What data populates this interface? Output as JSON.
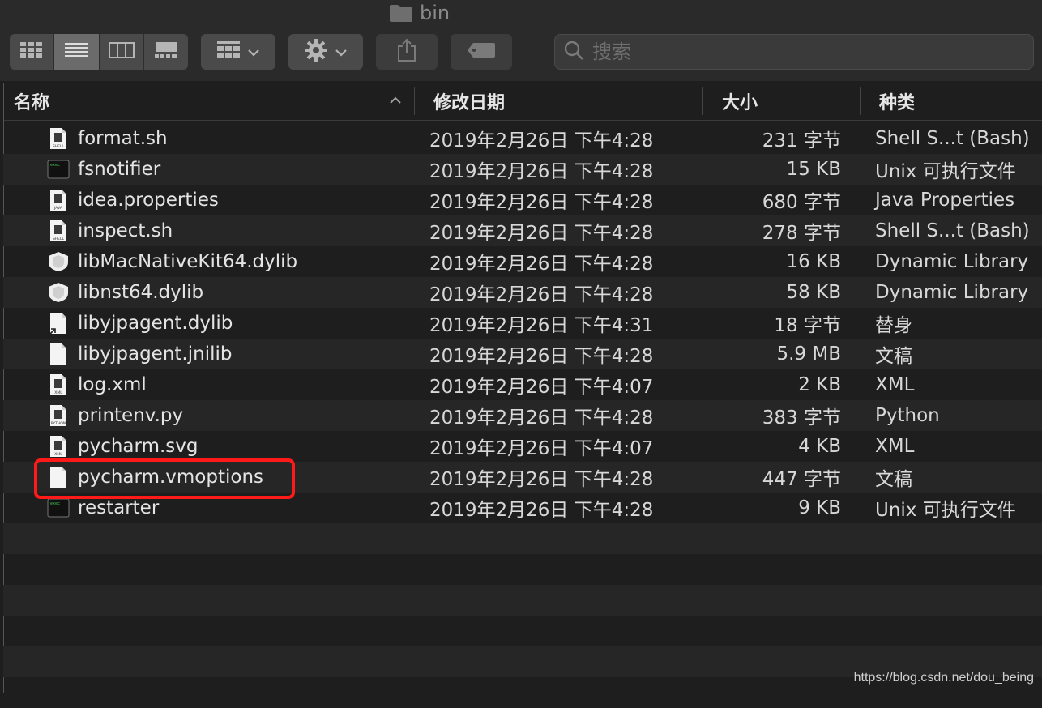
{
  "window": {
    "title": "bin"
  },
  "toolbar": {
    "search_placeholder": "搜索"
  },
  "columns": {
    "name": "名称",
    "date": "修改日期",
    "size": "大小",
    "kind": "种类"
  },
  "files": [
    {
      "name": "format.sh",
      "date": "2019年2月26日 下午4:28",
      "size": "231 字节",
      "kind": "Shell S...t (Bash)",
      "icon": "shell-doc-icon"
    },
    {
      "name": "fsnotifier",
      "date": "2019年2月26日 下午4:28",
      "size": "15 KB",
      "kind": "Unix 可执行文件",
      "icon": "terminal-exec-icon"
    },
    {
      "name": "idea.properties",
      "date": "2019年2月26日 下午4:28",
      "size": "680 字节",
      "kind": "Java Properties",
      "icon": "java-doc-icon"
    },
    {
      "name": "inspect.sh",
      "date": "2019年2月26日 下午4:28",
      "size": "278 字节",
      "kind": "Shell S...t (Bash)",
      "icon": "shell-doc-icon"
    },
    {
      "name": "libMacNativeKit64.dylib",
      "date": "2019年2月26日 下午4:28",
      "size": "16 KB",
      "kind": "Dynamic Library",
      "icon": "dylib-icon"
    },
    {
      "name": "libnst64.dylib",
      "date": "2019年2月26日 下午4:28",
      "size": "58 KB",
      "kind": "Dynamic Library",
      "icon": "dylib-icon"
    },
    {
      "name": "libyjpagent.dylib",
      "date": "2019年2月26日 下午4:31",
      "size": "18 字节",
      "kind": "替身",
      "icon": "alias-icon"
    },
    {
      "name": "libyjpagent.jnilib",
      "date": "2019年2月26日 下午4:28",
      "size": "5.9 MB",
      "kind": "文稿",
      "icon": "blank-doc-icon"
    },
    {
      "name": "log.xml",
      "date": "2019年2月26日 下午4:07",
      "size": "2 KB",
      "kind": "XML",
      "icon": "xml-doc-icon"
    },
    {
      "name": "printenv.py",
      "date": "2019年2月26日 下午4:28",
      "size": "383 字节",
      "kind": "Python",
      "icon": "python-doc-icon"
    },
    {
      "name": "pycharm.svg",
      "date": "2019年2月26日 下午4:07",
      "size": "4 KB",
      "kind": "XML",
      "icon": "xml-doc-icon"
    },
    {
      "name": "pycharm.vmoptions",
      "date": "2019年2月26日 下午4:28",
      "size": "447 字节",
      "kind": "文稿",
      "icon": "blank-doc-icon"
    },
    {
      "name": "restarter",
      "date": "2019年2月26日 下午4:28",
      "size": "9 KB",
      "kind": "Unix 可执行文件",
      "icon": "terminal-exec-icon"
    }
  ],
  "watermark": "https://blog.csdn.net/dou_being",
  "colors": {
    "highlight": "#ff1a1a",
    "background": "#1e1e1e",
    "toolbar": "#2a2a2a"
  }
}
